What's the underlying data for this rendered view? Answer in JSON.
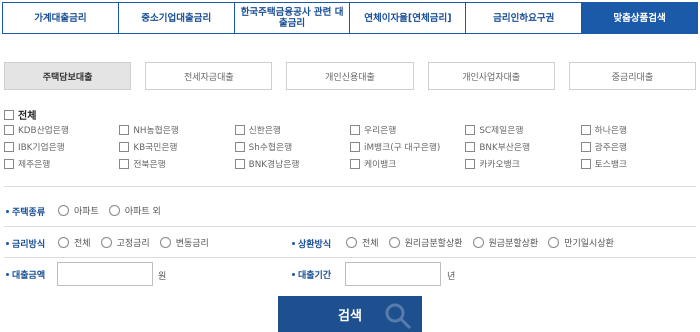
{
  "top_tabs": [
    {
      "label": "가계대출금리"
    },
    {
      "label": "중소기업대출금리"
    },
    {
      "label": "한국주택금융공사 관련 대출금리"
    },
    {
      "label": "연체이자율[연체금리]"
    },
    {
      "label": "금리인하요구권"
    },
    {
      "label": "맞춤상품검색"
    }
  ],
  "sub_tabs": [
    {
      "label": "주택담보대출"
    },
    {
      "label": "전세자금대출"
    },
    {
      "label": "개인신용대출"
    },
    {
      "label": "개인사업자대출"
    },
    {
      "label": "중금리대출"
    }
  ],
  "all_label": "전체",
  "banks": [
    "KDB산업은행",
    "NH농협은행",
    "신한은행",
    "우리은행",
    "SC제일은행",
    "하나은행",
    "IBK기업은행",
    "KB국민은행",
    "Sh수협은행",
    "iM뱅크(구 대구은행)",
    "BNK부산은행",
    "광주은행",
    "제주은행",
    "전북은행",
    "BNK경남은행",
    "케이뱅크",
    "카카오뱅크",
    "토스뱅크"
  ],
  "housing": {
    "label": "주택종류",
    "options": [
      "아파트",
      "아파트 외"
    ]
  },
  "rate_method": {
    "label": "금리방식",
    "options": [
      "전체",
      "고정금리",
      "변동금리"
    ]
  },
  "repay_method": {
    "label": "상환방식",
    "options": [
      "전체",
      "원리금분할상환",
      "원금분할상환",
      "만기일시상환"
    ]
  },
  "loan_amount": {
    "label": "대출금액",
    "unit": "원",
    "value": ""
  },
  "loan_period": {
    "label": "대출기간",
    "unit": "년",
    "value": ""
  },
  "search_label": "검색",
  "colors": {
    "primary": "#1a5aa8",
    "button": "#1e4f8f"
  }
}
